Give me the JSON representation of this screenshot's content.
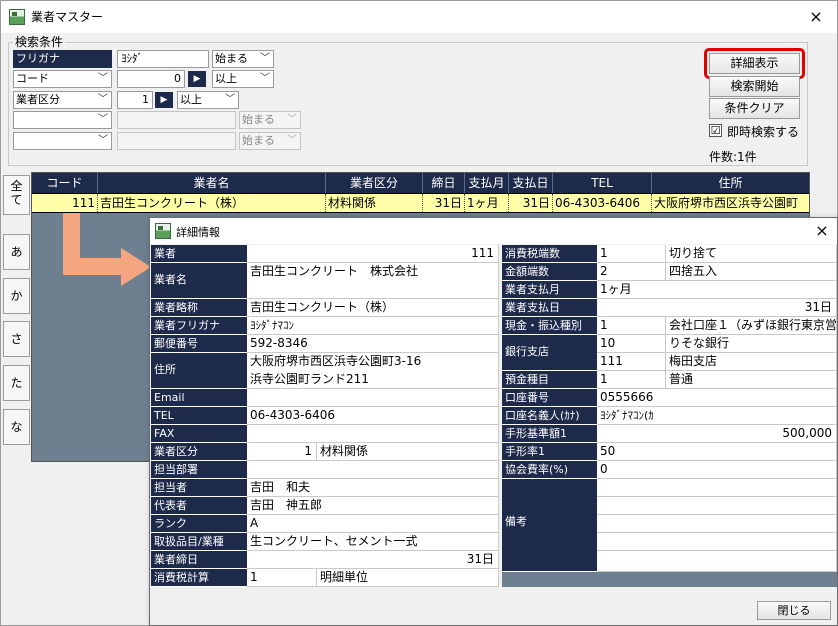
{
  "main": {
    "title": "業者マスター",
    "close": "×",
    "search_group_label": "検索条件",
    "criteria": [
      {
        "field": "フリガナ",
        "value": "ﾖｼﾀﾞ",
        "op": "始まる"
      },
      {
        "field": "コード",
        "value": "0",
        "op": "以上"
      },
      {
        "field": "業者区分",
        "value": "1",
        "op": "以上"
      },
      {
        "field": "",
        "value": "",
        "op": "始まる"
      },
      {
        "field": "",
        "value": "",
        "op": "始まる"
      }
    ],
    "buttons": {
      "detail": "詳細表示",
      "search": "検索開始",
      "clear": "条件クリア"
    },
    "instant_search": {
      "label": "即時検索する",
      "checked": "☑"
    },
    "count": "件数:1件",
    "kana_tabs": [
      "全て",
      "あ",
      "か",
      "さ",
      "た",
      "な"
    ],
    "grid": {
      "columns": [
        "コード",
        "業者名",
        "業者区分",
        "締日",
        "支払月",
        "支払日",
        "TEL",
        "住所"
      ],
      "rows": [
        [
          "111",
          "吉田生コンクリート（株）",
          "材料関係",
          "31日",
          "1ヶ月",
          "31日",
          "06-4303-6406",
          "大阪府堺市西区浜寺公園町"
        ]
      ]
    }
  },
  "detail": {
    "title": "詳細情報",
    "close": "×",
    "left": {
      "code": {
        "label": "業者",
        "value": "111"
      },
      "name": {
        "label": "業者名",
        "value": "吉田生コンクリート　株式会社"
      },
      "short_name": {
        "label": "業者略称",
        "value": "吉田生コンクリート（株）"
      },
      "kana": {
        "label": "業者フリガナ",
        "value": "ﾖｼﾀﾞﾅﾏｺﾝ"
      },
      "zip": {
        "label": "郵便番号",
        "value": "592-8346"
      },
      "address": {
        "label": "住所",
        "line1": "大阪府堺市西区浜寺公園町3-16",
        "line2": "浜寺公園町ランド211"
      },
      "email": {
        "label": "Email",
        "value": ""
      },
      "tel": {
        "label": "TEL",
        "value": "06-4303-6406"
      },
      "fax": {
        "label": "FAX",
        "value": ""
      },
      "category": {
        "label": "業者区分",
        "code": "1",
        "name": "材料関係"
      },
      "dept": {
        "label": "担当部署",
        "value": ""
      },
      "person": {
        "label": "担当者",
        "value": "吉田　和夫"
      },
      "rep": {
        "label": "代表者",
        "value": "吉田　神五郎"
      },
      "rank": {
        "label": "ランク",
        "value": "A"
      },
      "products": {
        "label": "取扱品目/業種",
        "value": "生コンクリート、セメント一式"
      },
      "closing": {
        "label": "業者締日",
        "value": "31日"
      },
      "tax_calc": {
        "label": "消費税計算",
        "code": "1",
        "name": "明細単位"
      }
    },
    "right": {
      "tax_round": {
        "label": "消費税端数",
        "code": "1",
        "name": "切り捨て"
      },
      "amount_round": {
        "label": "金額端数",
        "code": "2",
        "name": "四捨五入"
      },
      "pay_month": {
        "label": "業者支払月",
        "value": "1ヶ月"
      },
      "pay_day": {
        "label": "業者支払日",
        "value": "31日"
      },
      "transfer_type": {
        "label": "現金・振込種別",
        "code": "1",
        "name": "会社口座１（みずほ銀行東京営"
      },
      "bank": {
        "label": "銀行支店",
        "bank_code": "10",
        "bank_name": "りそな銀行",
        "branch_code": "111",
        "branch_name": "梅田支店"
      },
      "deposit_type": {
        "label": "預金種目",
        "code": "1",
        "name": "普通"
      },
      "account_no": {
        "label": "口座番号",
        "value": "0555666"
      },
      "account_holder": {
        "label": "口座名義人(ｶﾅ)",
        "value": "ﾖｼﾀﾞﾅﾏｺﾝ(ｶ"
      },
      "bill_base": {
        "label": "手形基準額1",
        "value": "500,000"
      },
      "bill_rate": {
        "label": "手形率1",
        "value": "50"
      },
      "assoc_rate": {
        "label": "協会費率(%)",
        "value": "0"
      },
      "notes": {
        "label": "備考",
        "value": ""
      }
    },
    "close_button": "閉じる"
  }
}
